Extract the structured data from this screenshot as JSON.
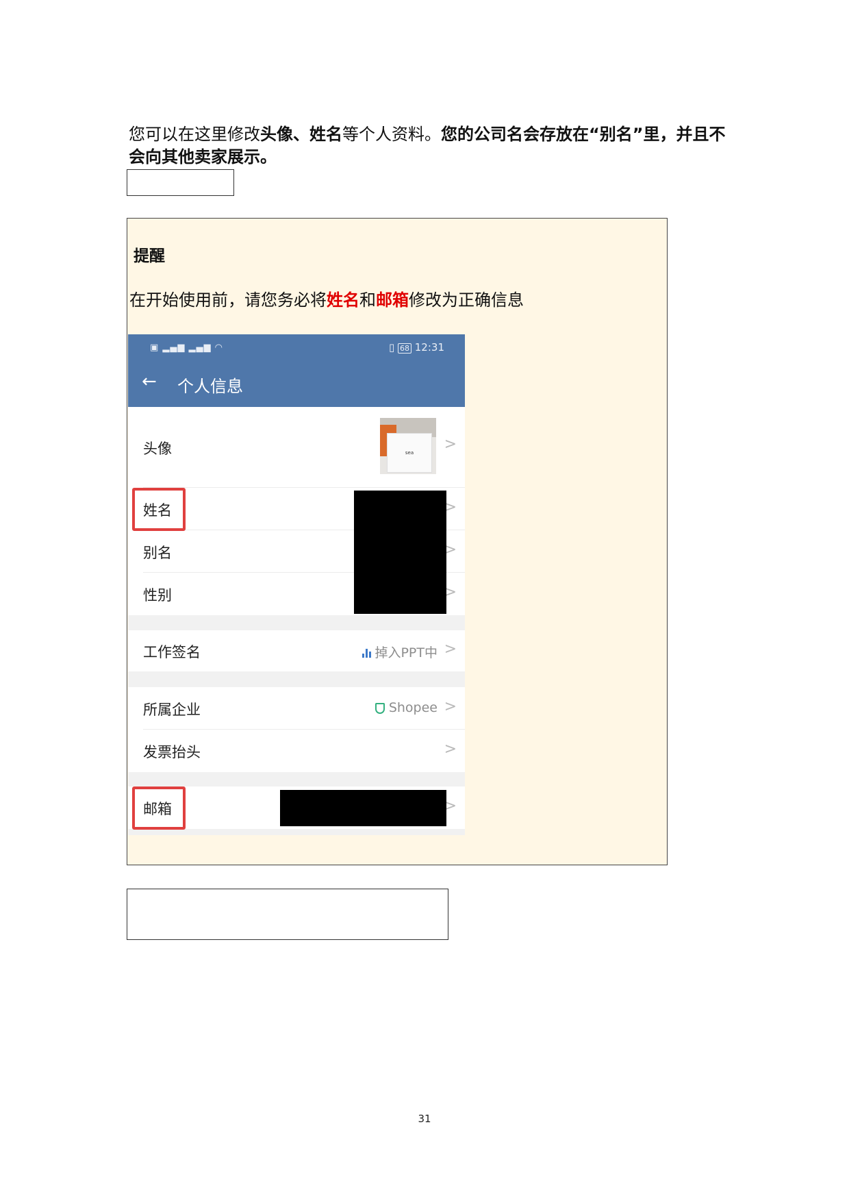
{
  "intro": {
    "part1": "您可以在这里修改",
    "bold1": "头像、姓名",
    "part2": "等个人资料。",
    "bold2": "您的公司名会存放在“别名”里，并且不会向其他卖家展示。"
  },
  "note": {
    "title": "提醒",
    "text_before": "在开始使用前，请您务必将",
    "red1": "姓名",
    "text_mid": "和",
    "red2": "邮箱",
    "text_after": "修改为正确信息"
  },
  "phone": {
    "status_time": "12:31",
    "status_battery": "68",
    "title": "个人信息",
    "rows": {
      "avatar": "头像",
      "name": "姓名",
      "alias": "别名",
      "gender": "性别",
      "work_status": "工作签名",
      "work_status_value": "掉入PPT中",
      "company": "所属企业",
      "company_value": "Shopee",
      "invoice": "发票抬头",
      "email": "邮箱"
    },
    "chevron": ">",
    "avatar_text": "sea"
  },
  "page_number": "31"
}
